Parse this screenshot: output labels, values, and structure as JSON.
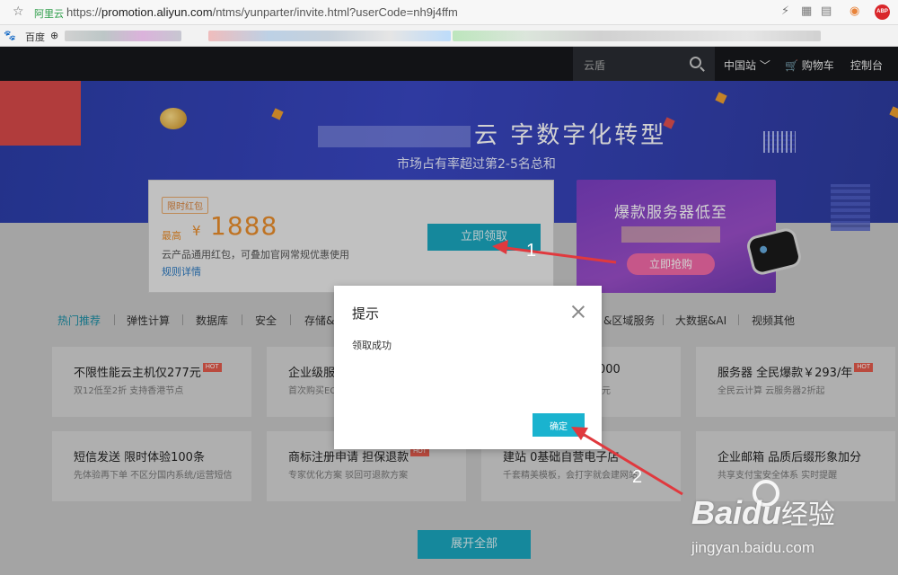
{
  "browser": {
    "site_name": "阿里云",
    "url_scheme": "https://",
    "url_host": "promotion.aliyun.com",
    "url_path": "/ntms/yunparter/invite.html?userCode=nh9j4ffm",
    "abp_label": "ABP",
    "bookmark_baidu": "百度"
  },
  "header": {
    "search_placeholder": "云盾",
    "region": "中国站",
    "cart": "购物车",
    "console": "控制台"
  },
  "banner": {
    "title_visible": "云   字数字化转型",
    "subtitle": "市场占有率超过第2-5名总和"
  },
  "coupon": {
    "tag": "限时红包",
    "max_label": "最高",
    "currency": "¥",
    "amount": "1888",
    "description": "云产品通用红包，可叠加官网常规优惠使用",
    "rules_link": "规则详情",
    "claim_button": "立即领取"
  },
  "promo": {
    "title": "爆款服务器低至",
    "button": "立即抢购"
  },
  "tabs": [
    "热门推荐",
    "弹性计算",
    "数据库",
    "安全",
    "存储&CDN",
    "&区域服务",
    "大数据&AI",
    "视频其他"
  ],
  "cards": [
    {
      "title": "不限性能云主机仅277元",
      "hot": "HOT",
      "sub": "双12低至2折 支持香港节点"
    },
    {
      "title": "企业级服",
      "hot": "",
      "sub": "首次购买EC"
    },
    {
      "title": "000",
      "hot": "",
      "sub": "元"
    },
    {
      "title": "服务器 全民爆款￥293/年",
      "hot": "HOT",
      "sub": "全民云计算 云服务器2折起"
    },
    {
      "title": "短信发送 限时体验100条",
      "hot": "",
      "sub": "先体验再下单 不区分国内系统/运营短信"
    },
    {
      "title": "商标注册申请 担保退款",
      "hot": "HOT",
      "sub": "专家优化方案 驳回可退款方案"
    },
    {
      "title": "建站 0基础自营电子店",
      "hot": "",
      "sub": "千套精美模板，会打字就会建网站"
    },
    {
      "title": "企业邮箱 品质后缀形象加分",
      "hot": "",
      "sub": "共享支付宝安全体系 实时提醒"
    }
  ],
  "expand_button": "展开全部",
  "modal": {
    "title": "提示",
    "message": "领取成功",
    "ok_button": "确定"
  },
  "annotations": [
    "1",
    "2"
  ],
  "watermark": {
    "logo_left": "Bai",
    "logo_right": "du",
    "logo_cn": "经验",
    "domain": "jingyan.baidu.com"
  },
  "colors": {
    "accent": "#1aa7bf",
    "coupon_orange": "#e98d2b",
    "annotation_red": "#e0393e"
  }
}
